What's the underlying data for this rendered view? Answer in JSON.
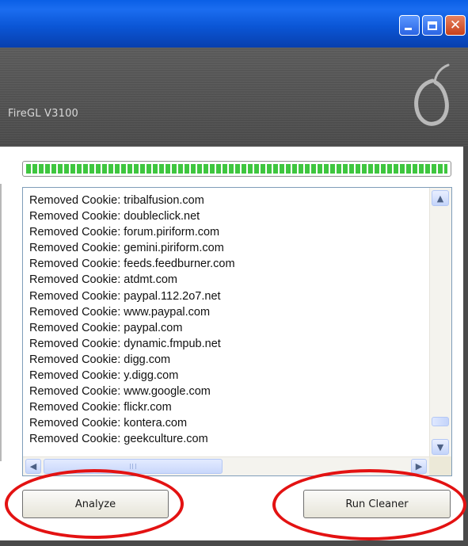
{
  "window": {
    "controls": [
      "minimize",
      "maximize",
      "close"
    ],
    "close_glyph": "✕"
  },
  "header": {
    "hardware_info": "FireGL V3100",
    "logo_icon": "pear-logo-icon"
  },
  "progress": {
    "percent": 100,
    "color": "#3fc63f"
  },
  "log": {
    "lines": [
      "Removed Cookie: tribalfusion.com",
      "Removed Cookie: doubleclick.net",
      "Removed Cookie: forum.piriform.com",
      "Removed Cookie: gemini.piriform.com",
      "Removed Cookie: feeds.feedburner.com",
      "Removed Cookie: atdmt.com",
      "Removed Cookie: paypal.112.2o7.net",
      "Removed Cookie: www.paypal.com",
      "Removed Cookie: paypal.com",
      "Removed Cookie: dynamic.fmpub.net",
      "Removed Cookie: digg.com",
      "Removed Cookie: y.digg.com",
      "Removed Cookie: www.google.com",
      "Removed Cookie: flickr.com",
      "Removed Cookie: kontera.com",
      "Removed Cookie: geekculture.com"
    ],
    "scroll_up_glyph": "▲",
    "scroll_down_glyph": "▼",
    "scroll_left_glyph": "◀",
    "scroll_right_glyph": "▶"
  },
  "buttons": {
    "analyze_label": "Analyze",
    "run_cleaner_label": "Run Cleaner"
  },
  "annotation": {
    "color": "#e31212"
  }
}
